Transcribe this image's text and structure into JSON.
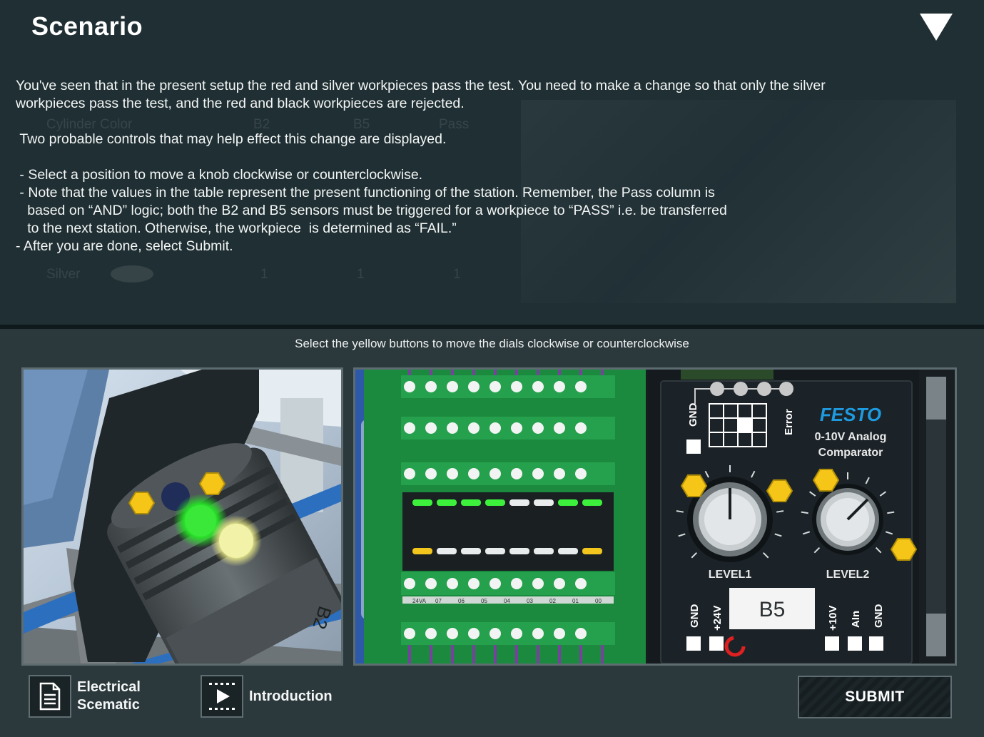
{
  "scenario": {
    "title": "Scenario",
    "paragraph_1_line_1": "You've seen that in the present setup the red and silver workpieces pass the test. You need to make a change so that only the silver",
    "paragraph_1_line_2": "workpieces pass the test, and the red and black workpieces are rejected.",
    "paragraph_2": " Two probable controls that may help effect this change are displayed.",
    "bullet_1": " - Select a position to move a knob clockwise or counterclockwise.",
    "bullet_2_line_1": " - Note that the values in the table represent the present functioning of the station. Remember, the Pass column is",
    "bullet_2_line_2": "   based on “AND” logic; both the B2 and B5 sensors must be triggered for a workpiece to “PASS” i.e. be transferred",
    "bullet_2_line_3": "   to the next station. Otherwise, the workpiece  is determined as “FAIL.”",
    "bullet_3": "- After you are done, select Submit."
  },
  "ghost_table": {
    "headers": [
      "Cylinder Color",
      "B2",
      "B5",
      "Pass"
    ],
    "last_row": [
      "Silver",
      "1",
      "1",
      "1"
    ]
  },
  "instruction": "Select the yellow buttons to move the dials clockwise or counterclockwise",
  "sensor_view": {
    "label": "B2"
  },
  "comparator": {
    "brand": "FESTO",
    "model_line_1": "0-10V Analog",
    "model_line_2": "Comparator",
    "level1_label": "LEVEL1",
    "level2_label": "LEVEL2",
    "sensor_label": "B5",
    "pin_gnd": "GND",
    "pin_24v": "+24V",
    "pin_10v": "+10V",
    "pin_ain": "AIn",
    "pin_gnd2": "GND",
    "top_gnd": "GND",
    "top_error": "Error"
  },
  "terminal_labels": [
    "24VA",
    "07",
    "06",
    "05",
    "04",
    "03",
    "02",
    "01",
    "00"
  ],
  "bottom": {
    "electrical_line_1": "Electrical",
    "electrical_line_2": "Scematic",
    "introduction": "Introduction",
    "submit": "SUBMIT"
  },
  "colors": {
    "accent_yellow": "#f5c518",
    "led_green": "#3cf03c",
    "festo_blue": "#1e9be0",
    "panel_dark": "#1f2f33"
  },
  "icons": [
    "triangle-down-icon",
    "document-icon",
    "play-icon"
  ]
}
